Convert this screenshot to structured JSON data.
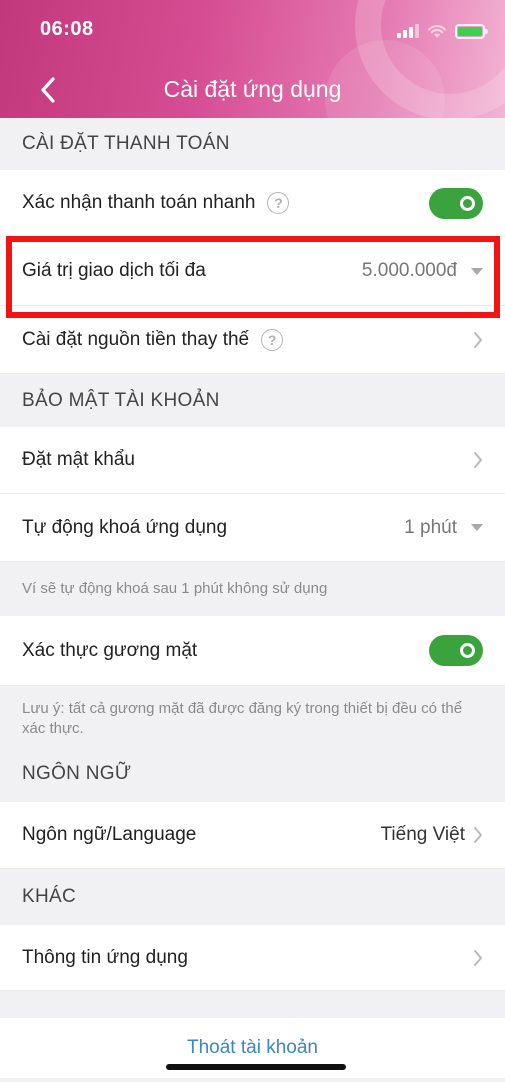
{
  "status_bar": {
    "time": "06:08"
  },
  "header": {
    "title": "Cài đặt ứng dụng"
  },
  "sections": {
    "payment": {
      "title": "CÀI ĐẶT THANH TOÁN",
      "quick_confirm": {
        "label": "Xác nhận thanh toán nhanh",
        "enabled": true
      },
      "max_transaction": {
        "label": "Giá trị giao dịch tối đa",
        "value": "5.000.000đ"
      },
      "alt_funding": {
        "label": "Cài đặt nguồn tiền thay thế"
      }
    },
    "security": {
      "title": "BẢO MẬT TÀI KHOẢN",
      "set_password": {
        "label": "Đặt mật khẩu"
      },
      "auto_lock": {
        "label": "Tự động khoá ứng dụng",
        "value": "1 phút"
      },
      "auto_lock_note": "Ví sẽ tự động khoá sau 1 phút không sử dụng",
      "face_auth": {
        "label": "Xác thực gương mặt",
        "enabled": true
      },
      "face_note": "Lưu ý: tất cả gương mặt đã được đăng ký trong thiết bị đều có thể xác thực."
    },
    "language": {
      "title": "NGÔN NGỮ",
      "language_row": {
        "label": "Ngôn ngữ/Language",
        "value": "Tiếng Việt"
      }
    },
    "other": {
      "title": "KHÁC",
      "app_info": {
        "label": "Thông tin ứng dụng"
      }
    }
  },
  "logout": {
    "label": "Thoát tài khoản"
  },
  "colors": {
    "brand_pink": "#d64d93",
    "toggle_green": "#3aa33d",
    "link_blue": "#3d86c6",
    "highlight_red": "#f11414"
  }
}
